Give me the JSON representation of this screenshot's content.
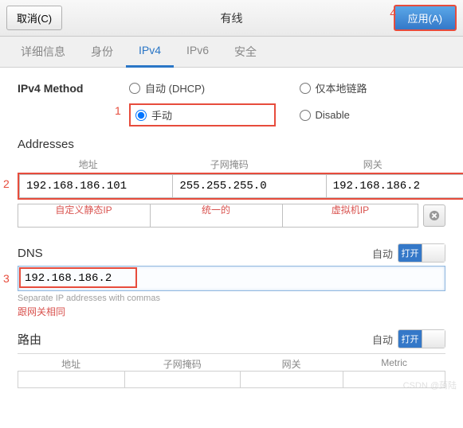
{
  "header": {
    "cancel_label": "取消(C)",
    "title": "有线",
    "apply_label": "应用(A)"
  },
  "annotations": {
    "n1": "1",
    "n2": "2",
    "n3": "3",
    "n4": "4"
  },
  "tabs": {
    "details": "详细信息",
    "identity": "身份",
    "ipv4": "IPv4",
    "ipv6": "IPv6",
    "security": "安全"
  },
  "ipv4": {
    "method_label": "IPv4 Method",
    "opt_dhcp": "自动 (DHCP)",
    "opt_linklocal": "仅本地链路",
    "opt_manual": "手动",
    "opt_disable": "Disable"
  },
  "addresses": {
    "title": "Addresses",
    "col_addr": "地址",
    "col_mask": "子网掩码",
    "col_gw": "网关",
    "rows": [
      {
        "addr": "192.168.186.101",
        "mask": "255.255.255.0",
        "gw": "192.168.186.2"
      }
    ],
    "hints": {
      "addr": "自定义静态IP",
      "mask": "统一的",
      "gw": "虚拟机IP"
    }
  },
  "dns": {
    "title": "DNS",
    "auto_label": "自动",
    "toggle_label": "打开",
    "value": "192.168.186.2",
    "helper": "Separate IP addresses with commas",
    "helper_red": "跟网关相同"
  },
  "routes": {
    "title": "路由",
    "auto_label": "自动",
    "toggle_label": "打开",
    "col_addr": "地址",
    "col_mask": "子网掩码",
    "col_gw": "网关",
    "col_metric": "Metric"
  },
  "watermark": "CSDN @蒟陆"
}
